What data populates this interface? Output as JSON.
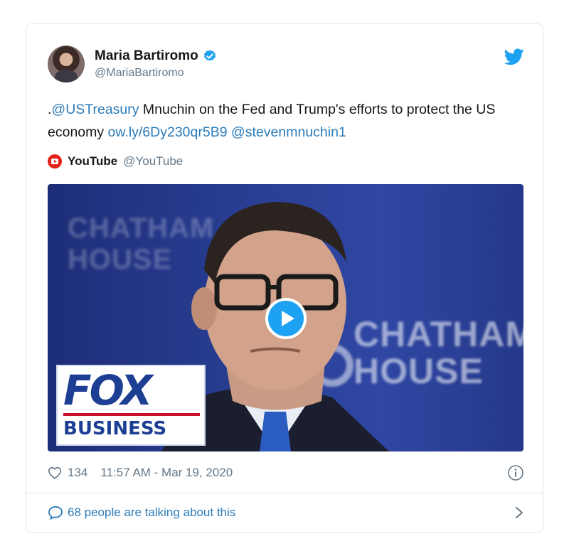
{
  "tweet": {
    "author": {
      "name": "Maria Bartiromo",
      "handle": "@MariaBartiromo",
      "verified": true
    },
    "text": {
      "prefix": ".",
      "mention1": "@USTreasury",
      "body": " Mnuchin on the Fed and Trump's efforts to protect the US economy ",
      "link": "ow.ly/6Dy230qr5B9",
      "space": " ",
      "mention2": "@stevenmnuchin1"
    },
    "source": {
      "name": "YouTube",
      "handle": "@YouTube"
    },
    "media": {
      "logo_top": "FOX",
      "logo_bottom": "BUSINESS",
      "bg_text_left": "CHATHAM\nHOUSE",
      "bg_text_right": "CHATHAM\nHOUSE"
    },
    "likes": "134",
    "timestamp": "11:57 AM - Mar 19, 2020",
    "talking": "68 people are talking about this"
  },
  "colors": {
    "link": "#2b7bb9",
    "twitter_blue": "#1da1f2",
    "youtube_red": "#e62117",
    "fox_blue": "#1c3f94"
  },
  "icons": [
    "verified-badge-icon",
    "twitter-bird-icon",
    "youtube-icon",
    "play-icon",
    "heart-icon",
    "info-icon",
    "speech-bubble-icon",
    "chevron-right-icon"
  ]
}
